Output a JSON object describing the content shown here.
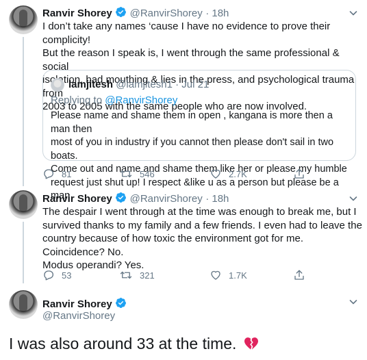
{
  "tweets": [
    {
      "name": "Ranvir Shorey",
      "handle": "@RanvirShorey",
      "time": "· 18h",
      "text": "I don’t take any names ‘cause I have no evidence to prove their complicity!\nBut the reason I speak is, I went through the same professional & social\nisolation, bad mouthing & lies in the press, and psychological trauma from\n2003 to 2005 with the same people who are now involved.",
      "quote": {
        "name": "lamjitesh",
        "handle": "@lamjitesh1",
        "time": "· Jul 21",
        "replying_prefix": "Replying to ",
        "replying_handle": "@RanvirShorey",
        "text": "Please name and shame them in open , kangana is more then a man then\nmost of you in industry  if you cannot then please don't sail in two boats.\nCome out and name and shame them like her or please my humble\nrequest just shut up! I respect &like u as a person but please be a man"
      },
      "replies": "81",
      "retweets": "546",
      "likes": "2.7K"
    },
    {
      "name": "Ranvir Shorey",
      "handle": "@RanvirShorey",
      "time": "· 18h",
      "text": "The despair I went through at the time was enough to break me, but I\nsurvived thanks to my family and a few friends. I even had to leave the\ncountry because of how toxic the environment got for me.\nCoincidence? No.\nModus operandi? Yes.",
      "replies": "53",
      "retweets": "321",
      "likes": "1.7K"
    }
  ],
  "main_tweet": {
    "name": "Ranvir Shorey",
    "handle": "@RanvirShorey",
    "text": "I was also around 33 at the time.",
    "emoji": "💔"
  },
  "icons": {
    "verified": "verified-badge-icon",
    "reply": "reply-icon",
    "retweet": "retweet-icon",
    "like": "heart-icon",
    "share": "share-icon",
    "more": "chevron-down-icon"
  },
  "colors": {
    "verified": "#1da1f2",
    "link": "#1b95e0",
    "muted": "#657786",
    "broken_heart": "#e0245e"
  }
}
